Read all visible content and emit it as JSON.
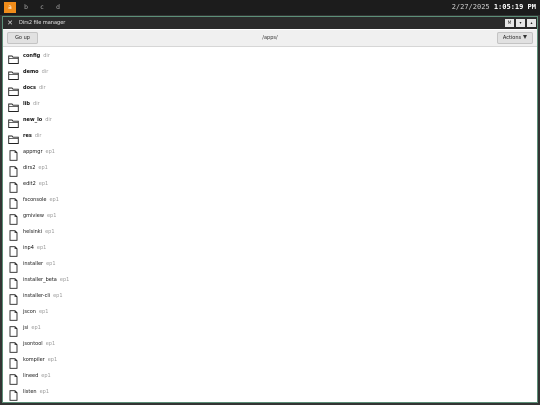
{
  "taskbar": {
    "workspaces": [
      {
        "label": "a",
        "active": true
      },
      {
        "label": "b",
        "active": false
      },
      {
        "label": "c",
        "active": false
      },
      {
        "label": "d",
        "active": false
      }
    ],
    "date": "2/27/2025",
    "time": "1:05:19 PM"
  },
  "window": {
    "title": "Dirs2 file manager",
    "close_glyph": "✕",
    "buttons": {
      "maximize": "M",
      "down": "▾",
      "up": "▴"
    }
  },
  "toolbar": {
    "go_up_label": "Go up",
    "path": "/apps/",
    "actions_label": "Actions"
  },
  "files": [
    {
      "name": "config",
      "kind": "dir"
    },
    {
      "name": "demo",
      "kind": "dir"
    },
    {
      "name": "docs",
      "kind": "dir"
    },
    {
      "name": "lib",
      "kind": "dir"
    },
    {
      "name": "new_lo",
      "kind": "dir"
    },
    {
      "name": "res",
      "kind": "dir"
    },
    {
      "name": "appmgr",
      "kind": "ep1"
    },
    {
      "name": "dirs2",
      "kind": "ep1"
    },
    {
      "name": "edit2",
      "kind": "ep1"
    },
    {
      "name": "fsconsole",
      "kind": "ep1"
    },
    {
      "name": "gmiview",
      "kind": "ep1"
    },
    {
      "name": "helsinki",
      "kind": "ep1"
    },
    {
      "name": "inp4",
      "kind": "ep1"
    },
    {
      "name": "installer",
      "kind": "ep1"
    },
    {
      "name": "installer_beta",
      "kind": "ep1"
    },
    {
      "name": "installer-cli",
      "kind": "ep1"
    },
    {
      "name": "jscon",
      "kind": "ep1"
    },
    {
      "name": "jsi",
      "kind": "ep1"
    },
    {
      "name": "jsontool",
      "kind": "ep1"
    },
    {
      "name": "kompiler",
      "kind": "ep1"
    },
    {
      "name": "lineed",
      "kind": "ep1"
    },
    {
      "name": "listen",
      "kind": "ep1"
    }
  ],
  "colors": {
    "accent": "#f08c1a",
    "window_border": "#5c8f78"
  },
  "icons": {
    "dir": "folder-icon",
    "ep1": "file-icon"
  }
}
